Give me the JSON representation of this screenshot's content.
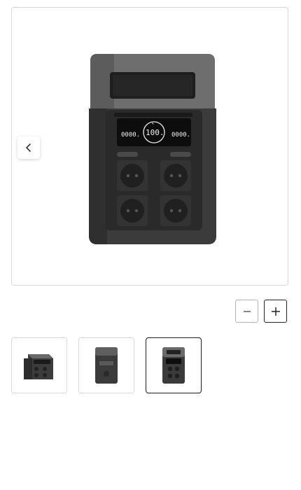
{
  "gallery": {
    "product_image_icon": "power-station-front",
    "display": {
      "left_readout": "0000.",
      "center_readout": "100.",
      "center_unit": "%",
      "right_readout": "0000."
    }
  },
  "controls": {
    "prev_icon": "chevron-left-icon",
    "zoom_out_icon": "minus-icon",
    "zoom_in_icon": "plus-icon"
  },
  "thumbnails": [
    {
      "icon": "power-station-angle-view",
      "selected": false
    },
    {
      "icon": "power-station-back-view",
      "selected": false
    },
    {
      "icon": "power-station-front-view",
      "selected": true
    }
  ],
  "colors": {
    "border": "#d9d9d9",
    "selected_border": "#1e1e1e",
    "device_body": "#3a3a3a",
    "device_top": "#6b6b6b"
  }
}
